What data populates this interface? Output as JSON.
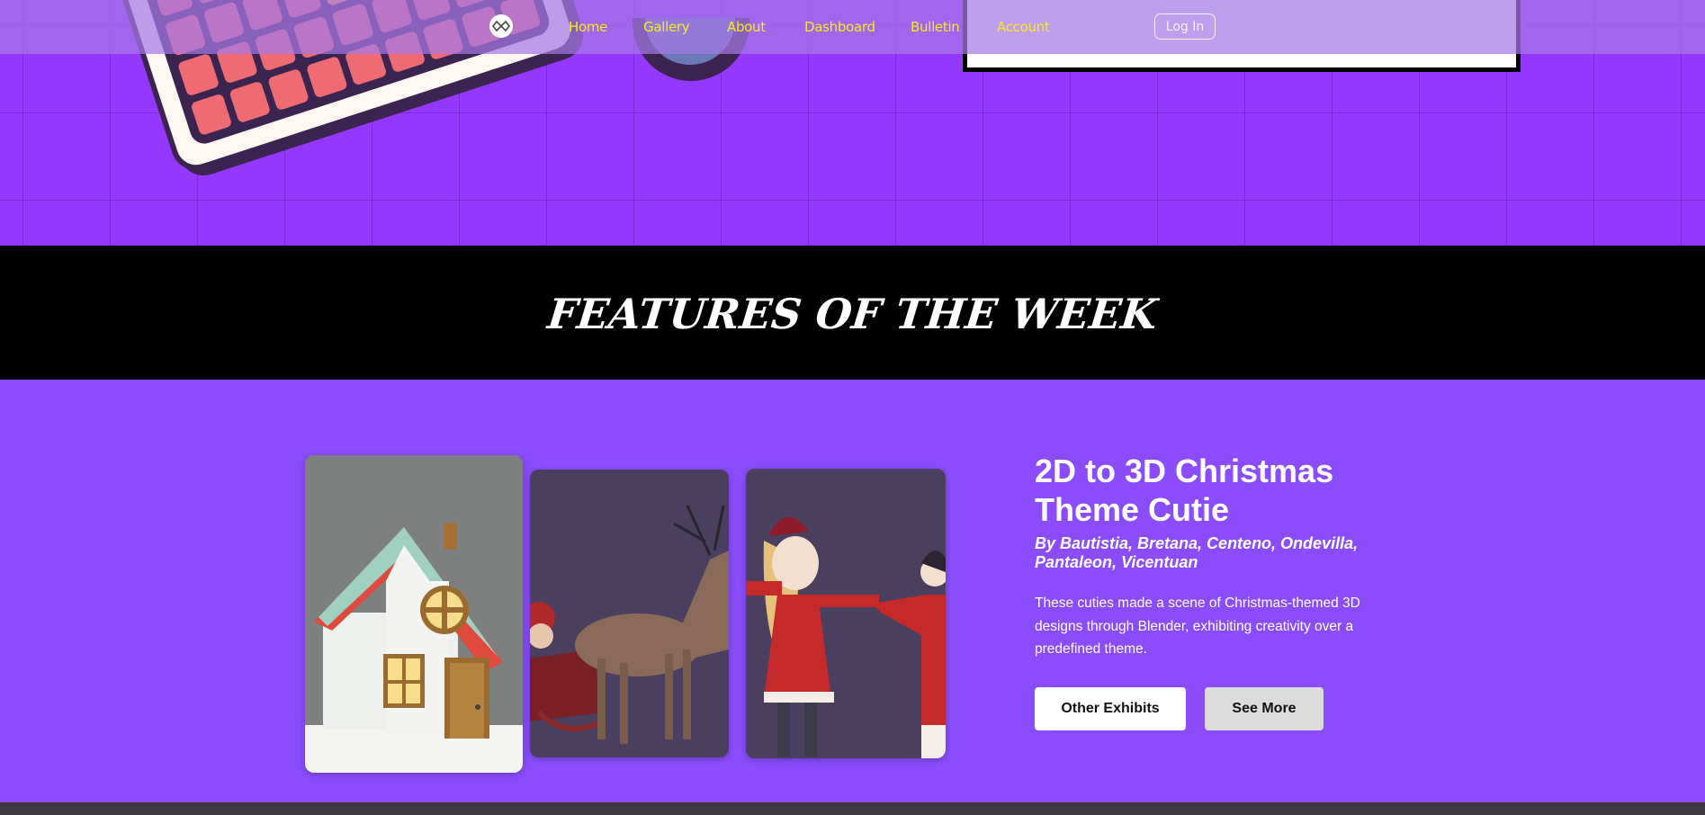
{
  "navbar": {
    "logo_icon": "logo-icon",
    "links": [
      "Home",
      "Gallery",
      "About",
      "Dashboard",
      "Bulletin",
      "Account"
    ],
    "login_label": "Log In",
    "link_color": "#f7ea1f"
  },
  "band": {
    "title": "FEATURES OF THE WEEK"
  },
  "feature": {
    "title": "2D to 3D Christmas Theme Cutie",
    "authors": "By Bautistia, Bretana, Centeno, Ondevilla, Pantaleon, Vicentuan",
    "description": "These cuties made a scene of Christmas-themed 3D designs through Blender, exhibiting creativity over a predefined theme.",
    "buttons": {
      "other_exhibits": "Other Exhibits",
      "see_more": "See More"
    },
    "images": [
      "house-image",
      "reindeer-image",
      "santa-image"
    ]
  },
  "colors": {
    "hero_bg": "#9538fd",
    "section_bg": "#8b4dfc",
    "band_bg": "#000000"
  }
}
